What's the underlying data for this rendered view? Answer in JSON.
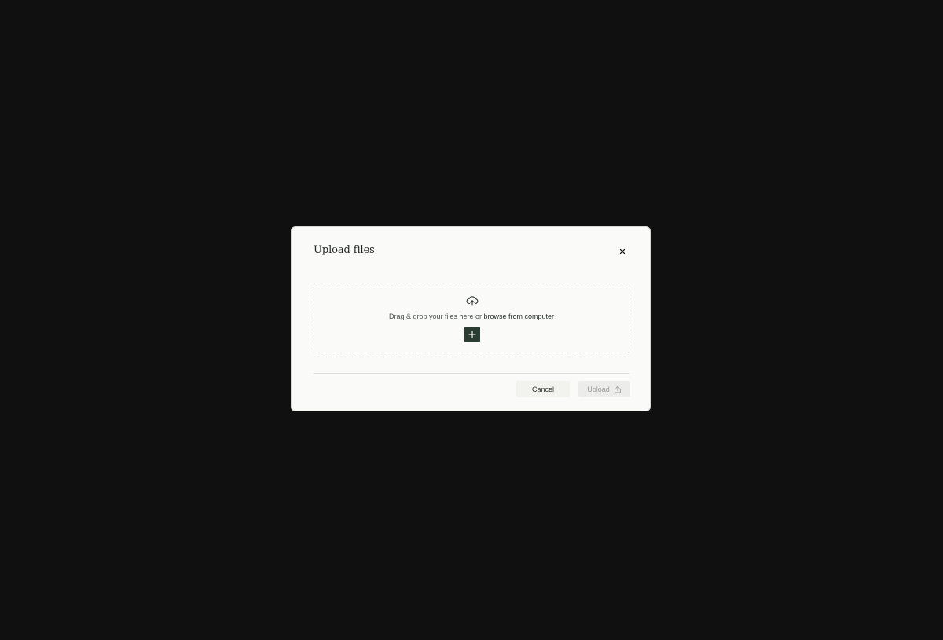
{
  "dialog": {
    "title": "Upload files",
    "close_icon": "close-icon"
  },
  "dropzone": {
    "icon": "cloud-upload-icon",
    "text_prefix": "Drag & drop your files here or ",
    "browse_link": "browse from computer",
    "add_icon": "plus-icon"
  },
  "footer": {
    "cancel_label": "Cancel",
    "upload_label": "Upload",
    "upload_icon": "upload-icon"
  },
  "colors": {
    "backdrop": "#101010",
    "dialog_bg": "#fafaf8",
    "accent": "#2b3d33",
    "disabled_text": "#9a9d99"
  }
}
